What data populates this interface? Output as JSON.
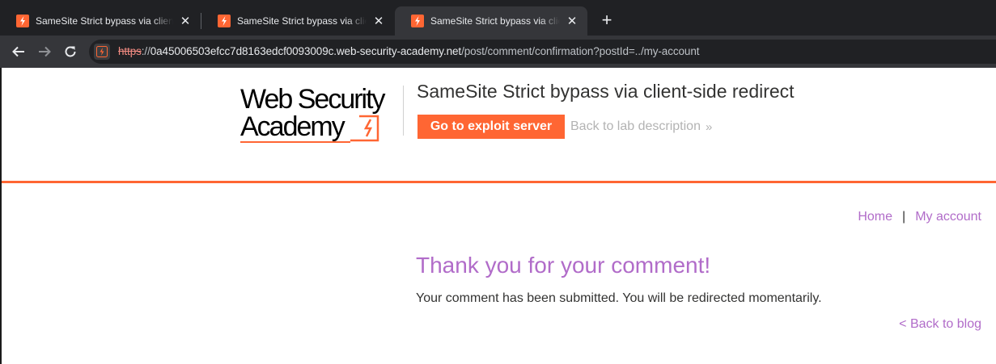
{
  "browser": {
    "tabs": [
      {
        "title": "SameSite Strict bypass via client-side redirect",
        "active": false
      },
      {
        "title": "SameSite Strict bypass via client-side redirect",
        "active": false
      },
      {
        "title": "SameSite Strict bypass via client-side redirect",
        "active": true
      }
    ],
    "new_tab_label": "+",
    "close_label": "✕",
    "url": {
      "scheme": "https",
      "separator": "://",
      "host": "0a45006503efcc7d8163edcf0093009c.web-security-academy.net",
      "path": "/post/comment/confirmation?postId=../my-account"
    }
  },
  "academy": {
    "logo_line1": "Web Security",
    "logo_line2": "Academy",
    "lab_title": "SameSite Strict bypass via client-side redirect",
    "exploit_button": "Go to exploit server",
    "back_to_lab": "Back to lab description",
    "chevron": "»",
    "accent_color": "#ff6633"
  },
  "nav": {
    "home": "Home",
    "separator": "|",
    "my_account": "My account"
  },
  "content": {
    "heading": "Thank you for your comment!",
    "message": "Your comment has been submitted. You will be redirected momentarily.",
    "back_to_blog": "< Back to blog",
    "link_color": "#b16cc9"
  }
}
